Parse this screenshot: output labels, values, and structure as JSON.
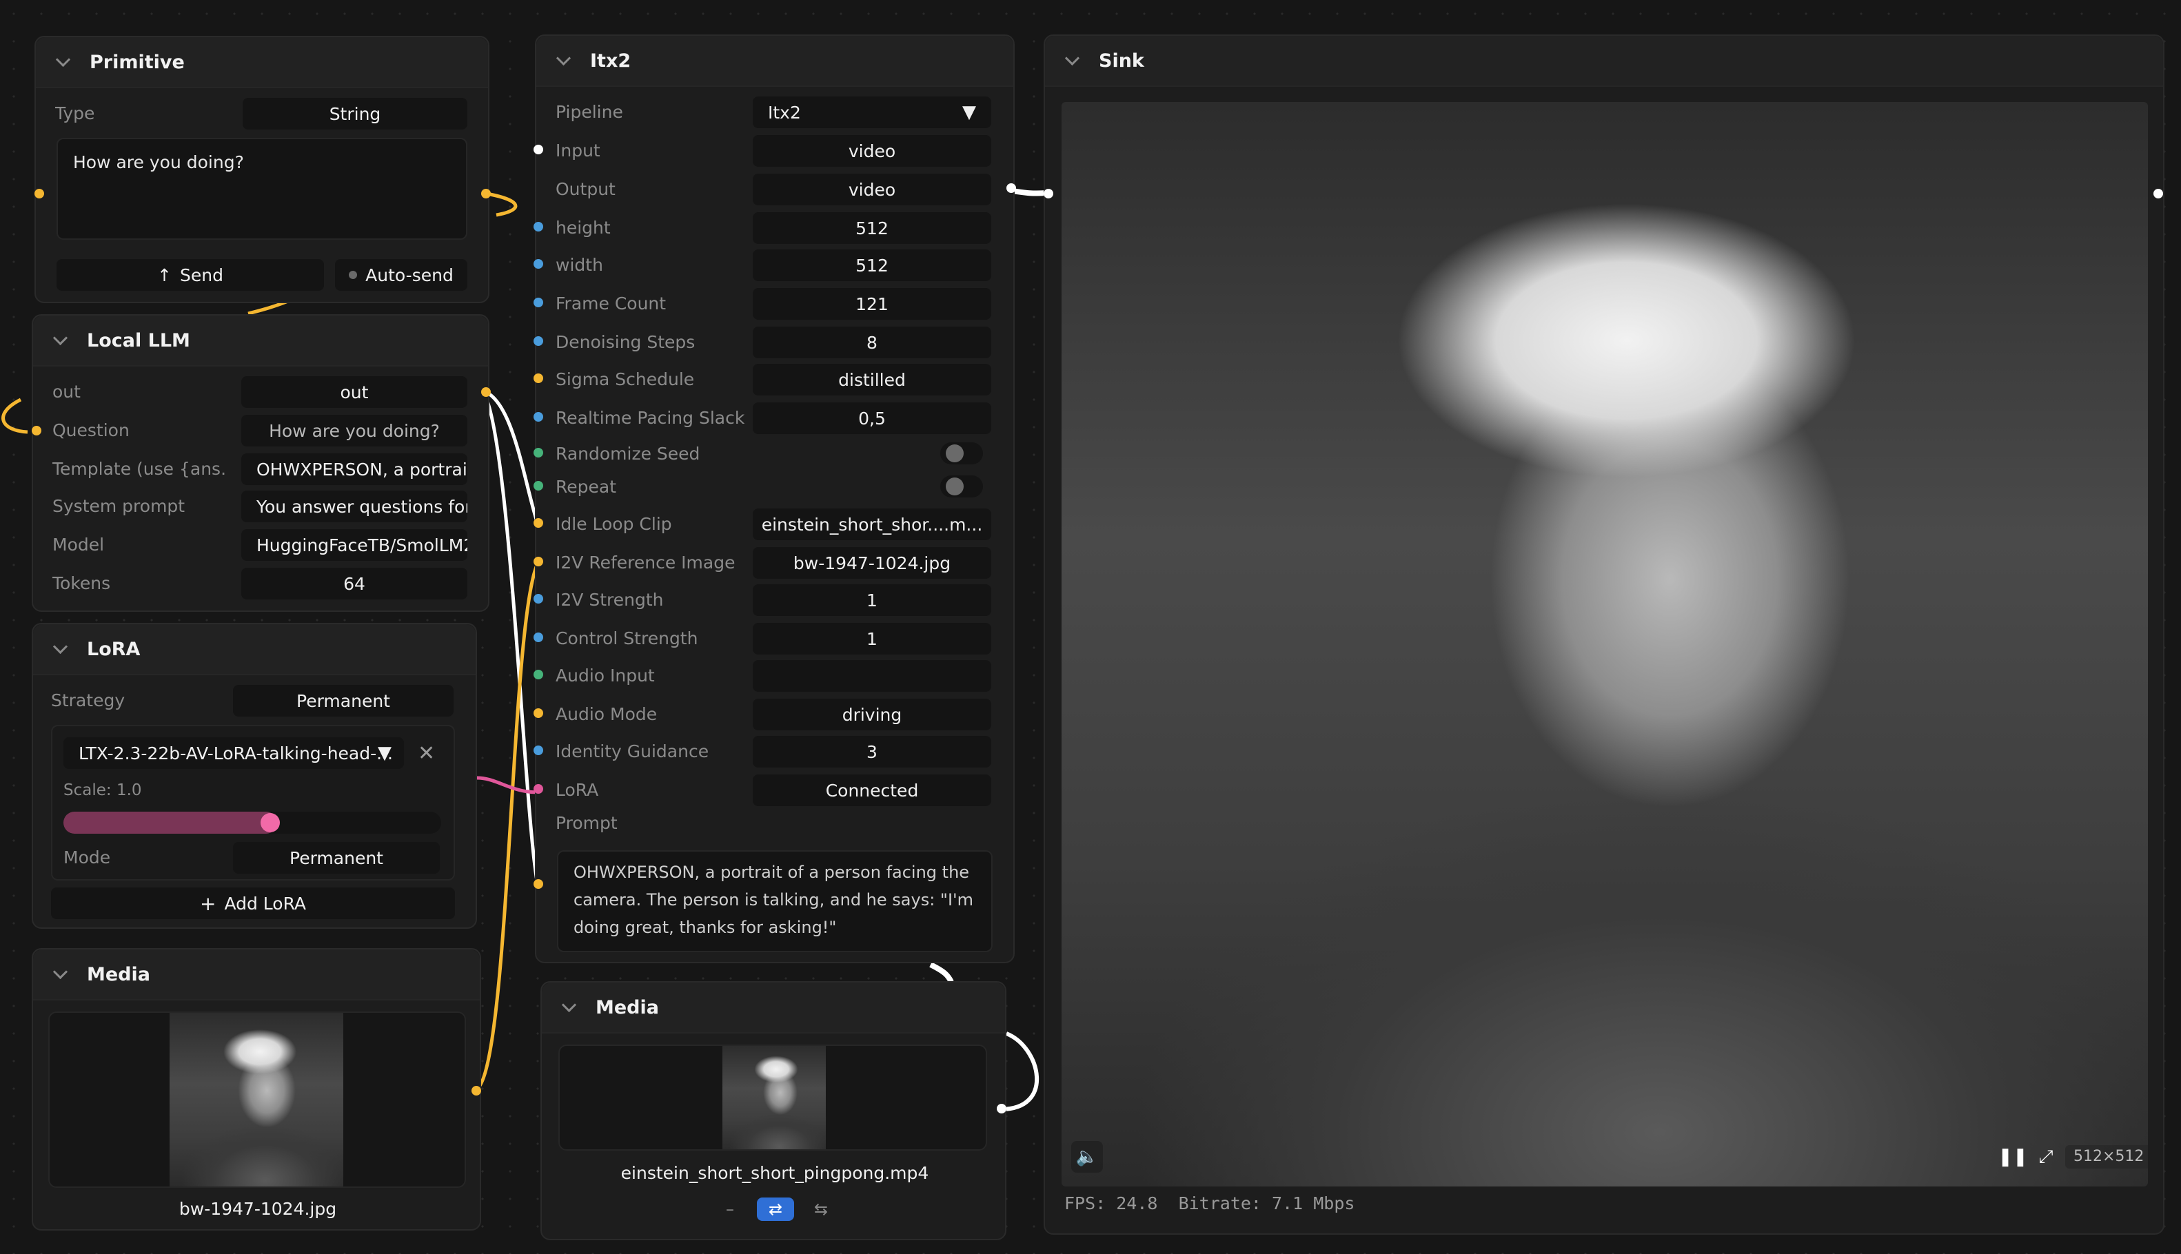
{
  "primitive": {
    "title": "Primitive",
    "type_label": "Type",
    "type_value": "String",
    "text_value": "How are you doing?",
    "send_label": "Send",
    "autosend_label": "Auto-send"
  },
  "local_llm": {
    "title": "Local LLM",
    "rows": [
      {
        "label": "out",
        "value": "out"
      },
      {
        "label": "Question",
        "value": "How are you doing?"
      },
      {
        "label": "Template (use {ans...",
        "value": "OHWXPERSON, a portrait o"
      },
      {
        "label": "System prompt",
        "value": "You answer questions for"
      },
      {
        "label": "Model",
        "value": "HuggingFaceTB/SmolLM2"
      },
      {
        "label": "Tokens",
        "value": "64"
      }
    ]
  },
  "lora": {
    "title": "LoRA",
    "strategy_label": "Strategy",
    "strategy_value": "Permanent",
    "selected_lora": "LTX-2.3-22b-AV-LoRA-talking-head-...",
    "scale_label": "Scale: 1.0",
    "scale_fraction": 0.6,
    "mode_label": "Mode",
    "mode_value": "Permanent",
    "add_label": "Add LoRA"
  },
  "media_left": {
    "title": "Media",
    "filename": "bw-1947-1024.jpg"
  },
  "itx2": {
    "title": "Itx2",
    "pipeline_label": "Pipeline",
    "pipeline_value": "Itx2",
    "rows": [
      {
        "label": "Input",
        "value": "video",
        "port": "white"
      },
      {
        "label": "Output",
        "value": "video",
        "port": ""
      },
      {
        "label": "height",
        "value": "512",
        "port": "blue"
      },
      {
        "label": "width",
        "value": "512",
        "port": "blue"
      },
      {
        "label": "Frame Count",
        "value": "121",
        "port": "blue"
      },
      {
        "label": "Denoising Steps",
        "value": "8",
        "port": "blue"
      },
      {
        "label": "Sigma Schedule",
        "value": "distilled",
        "port": "yellow"
      },
      {
        "label": "Realtime Pacing Slack",
        "value": "0,5",
        "port": "blue"
      }
    ],
    "toggles": [
      {
        "label": "Randomize Seed",
        "port": "green"
      },
      {
        "label": "Repeat",
        "port": "green"
      }
    ],
    "rows2": [
      {
        "label": "Idle Loop Clip",
        "value": "einstein_short_shor....m...",
        "port": "yellow"
      },
      {
        "label": "I2V Reference Image",
        "value": "bw-1947-1024.jpg",
        "port": "yellow"
      },
      {
        "label": "I2V Strength",
        "value": "1",
        "port": "blue"
      },
      {
        "label": "Control Strength",
        "value": "1",
        "port": "blue"
      },
      {
        "label": "Audio Input",
        "value": "",
        "port": "green"
      },
      {
        "label": "Audio Mode",
        "value": "driving",
        "port": "yellow"
      },
      {
        "label": "Identity Guidance",
        "value": "3",
        "port": "blue"
      },
      {
        "label": "LoRA",
        "value": "Connected",
        "port": "pink"
      }
    ],
    "prompt_label": "Prompt",
    "prompt_value": "OHWXPERSON, a portrait of a person facing the camera. The person is talking, and he says: \"I'm doing great, thanks for asking!\""
  },
  "media_mid": {
    "title": "Media",
    "filename": "einstein_short_short_pingpong.mp4"
  },
  "sink": {
    "title": "Sink",
    "resolution": "512×512",
    "stats": "FPS: 24.8  Bitrate: 7.1 Mbps"
  },
  "colors": {
    "wire_white": "#ffffff",
    "wire_yellow": "#f5b731",
    "wire_pink": "#e0579a",
    "accent_blue": "#2f6fd6"
  }
}
